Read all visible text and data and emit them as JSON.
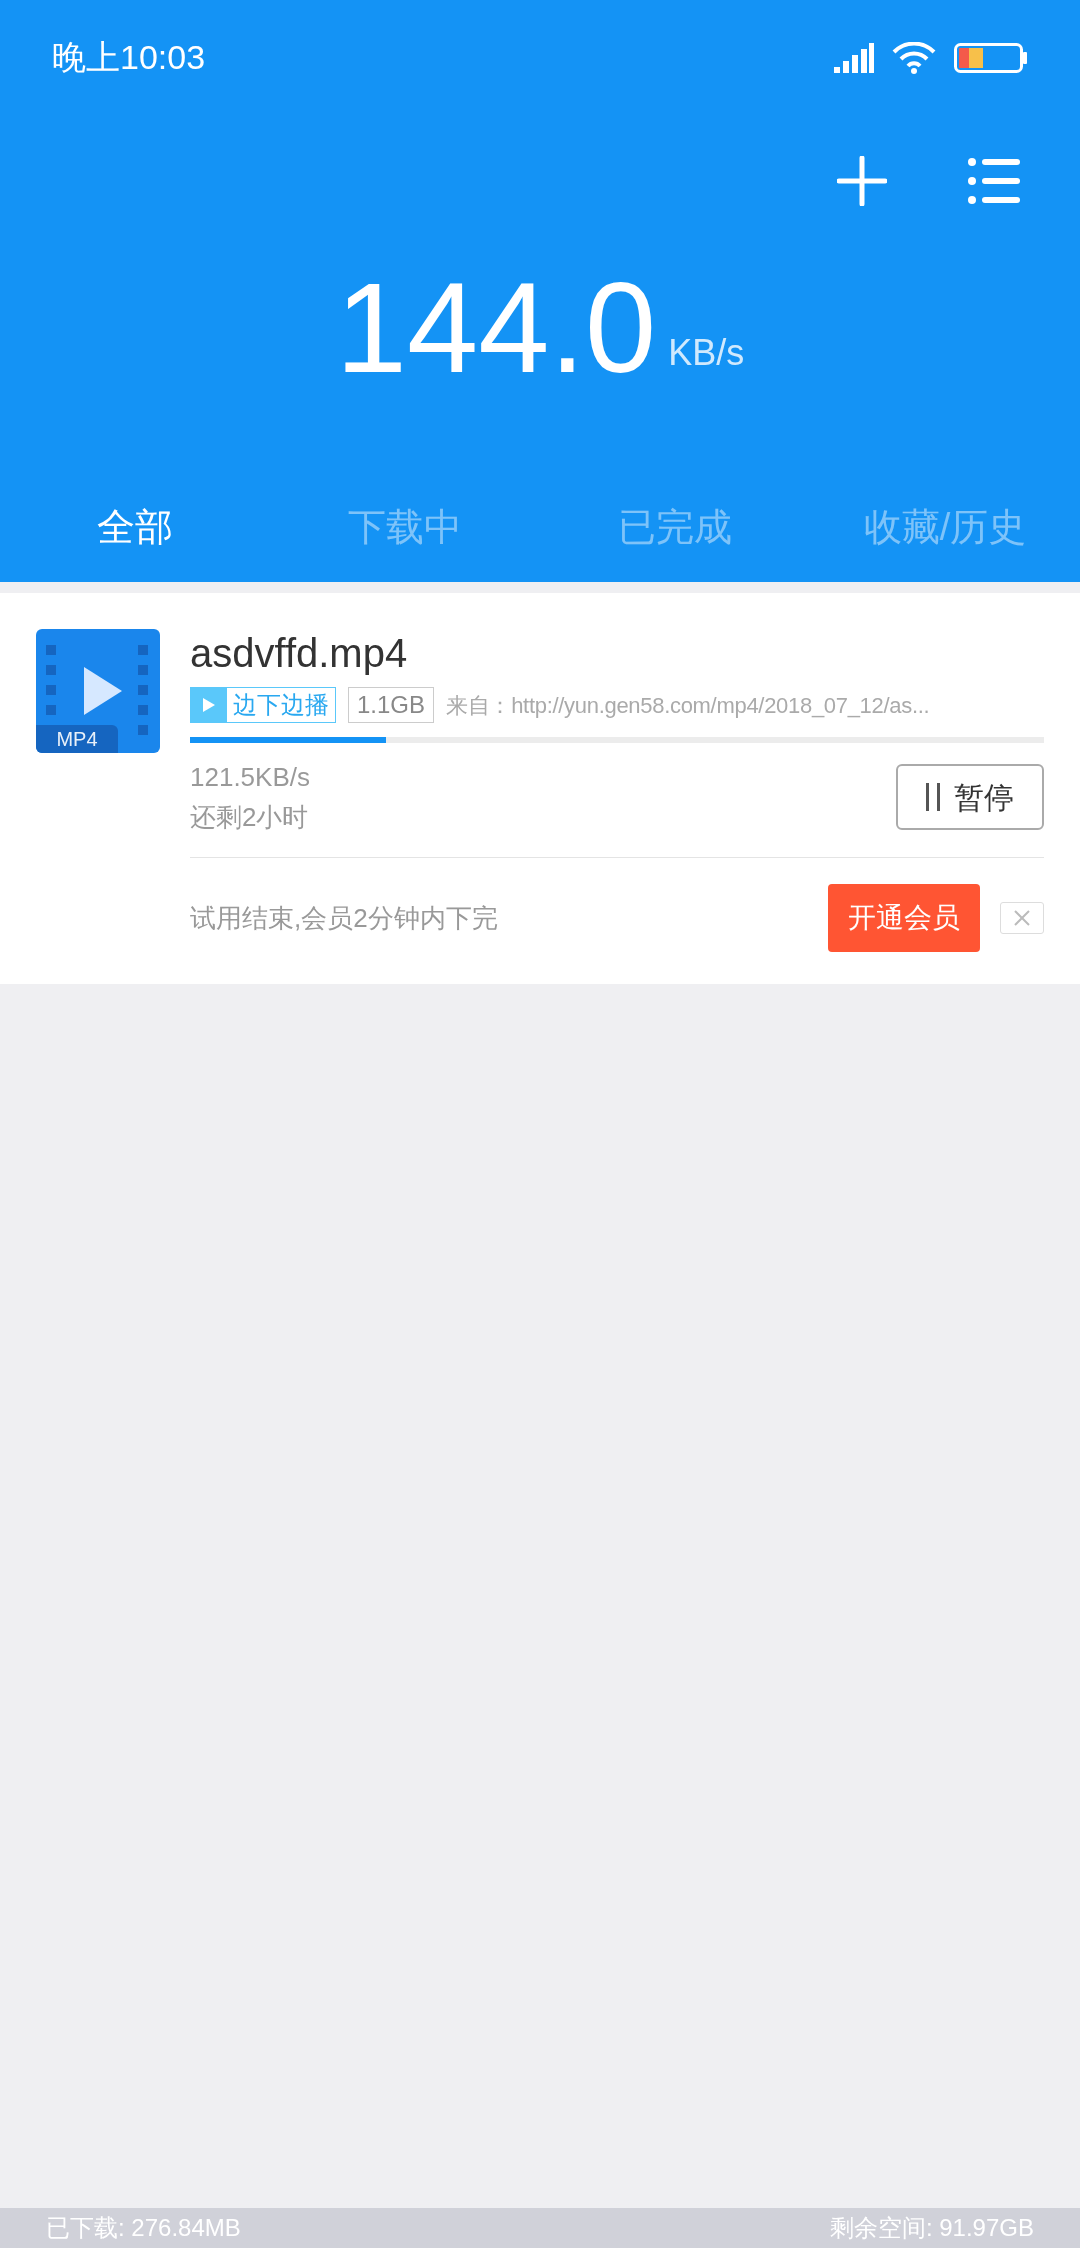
{
  "status_bar": {
    "time": "晚上10:03"
  },
  "header": {
    "speed": "144.0",
    "unit": "KB/s"
  },
  "tabs": [
    {
      "label": "全部",
      "selected": true
    },
    {
      "label": "下载中",
      "selected": false
    },
    {
      "label": "已完成",
      "selected": false
    },
    {
      "label": "收藏/历史",
      "selected": false
    }
  ],
  "downloads": [
    {
      "file_type": "MP4",
      "name": "asdvffd.mp4",
      "play_tag": "边下边播",
      "size": "1.1GB",
      "source": "来自：http://yun.gen58.com/mp4/2018_07_12/as...",
      "level": 0.23,
      "speed": "121.5KB/s",
      "remaining": "还剩2小时",
      "pause_button": "暂停",
      "promo": "试用结束,会员2分钟内下完",
      "promo_button": "开通会员"
    }
  ],
  "footer": {
    "downloaded": "已下载: 276.84MB",
    "free_space": "剩余空间: 91.97GB"
  }
}
